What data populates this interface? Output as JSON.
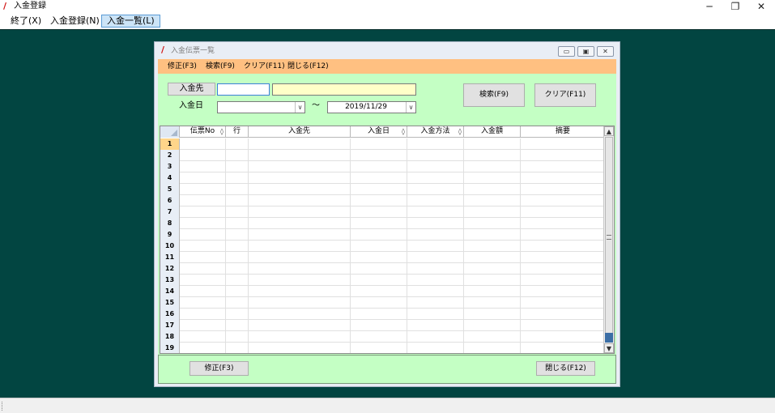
{
  "window": {
    "title": "入金登録",
    "minimize": "─",
    "restore": "❐",
    "close": "✕"
  },
  "menubar": {
    "items": [
      {
        "label": "終了(X)"
      },
      {
        "label": "入金登録(N)"
      },
      {
        "label": "入金一覧(L)"
      }
    ]
  },
  "child": {
    "title": "入金伝票一覧",
    "menu": [
      {
        "label": "修正(F3)"
      },
      {
        "label": "検索(F9)"
      },
      {
        "label": "クリア(F11)"
      },
      {
        "label": "閉じる(F12)"
      }
    ],
    "filter": {
      "customer_button": "入金先",
      "customer_code": "",
      "customer_name": "",
      "date_label": "入金日",
      "date_from": "",
      "tilde": "〜",
      "date_to": "2019/11/29",
      "search_button": "検索(F9)",
      "clear_button": "クリア(F11)"
    },
    "grid": {
      "columns": [
        {
          "label": "伝票No",
          "sortable": true
        },
        {
          "label": "行",
          "sortable": false
        },
        {
          "label": "入金先",
          "sortable": false
        },
        {
          "label": "入金日",
          "sortable": true
        },
        {
          "label": "入金方法",
          "sortable": true
        },
        {
          "label": "入金額",
          "sortable": false
        },
        {
          "label": "摘要",
          "sortable": false
        }
      ],
      "sort_glyph": "◊",
      "row_numbers": [
        "1",
        "2",
        "3",
        "4",
        "5",
        "6",
        "7",
        "8",
        "9",
        "10",
        "11",
        "12",
        "13",
        "14",
        "15",
        "16",
        "17",
        "18",
        "19"
      ]
    },
    "footer": {
      "edit_button": "修正(F3)",
      "close_button": "閉じる(F12)"
    }
  }
}
